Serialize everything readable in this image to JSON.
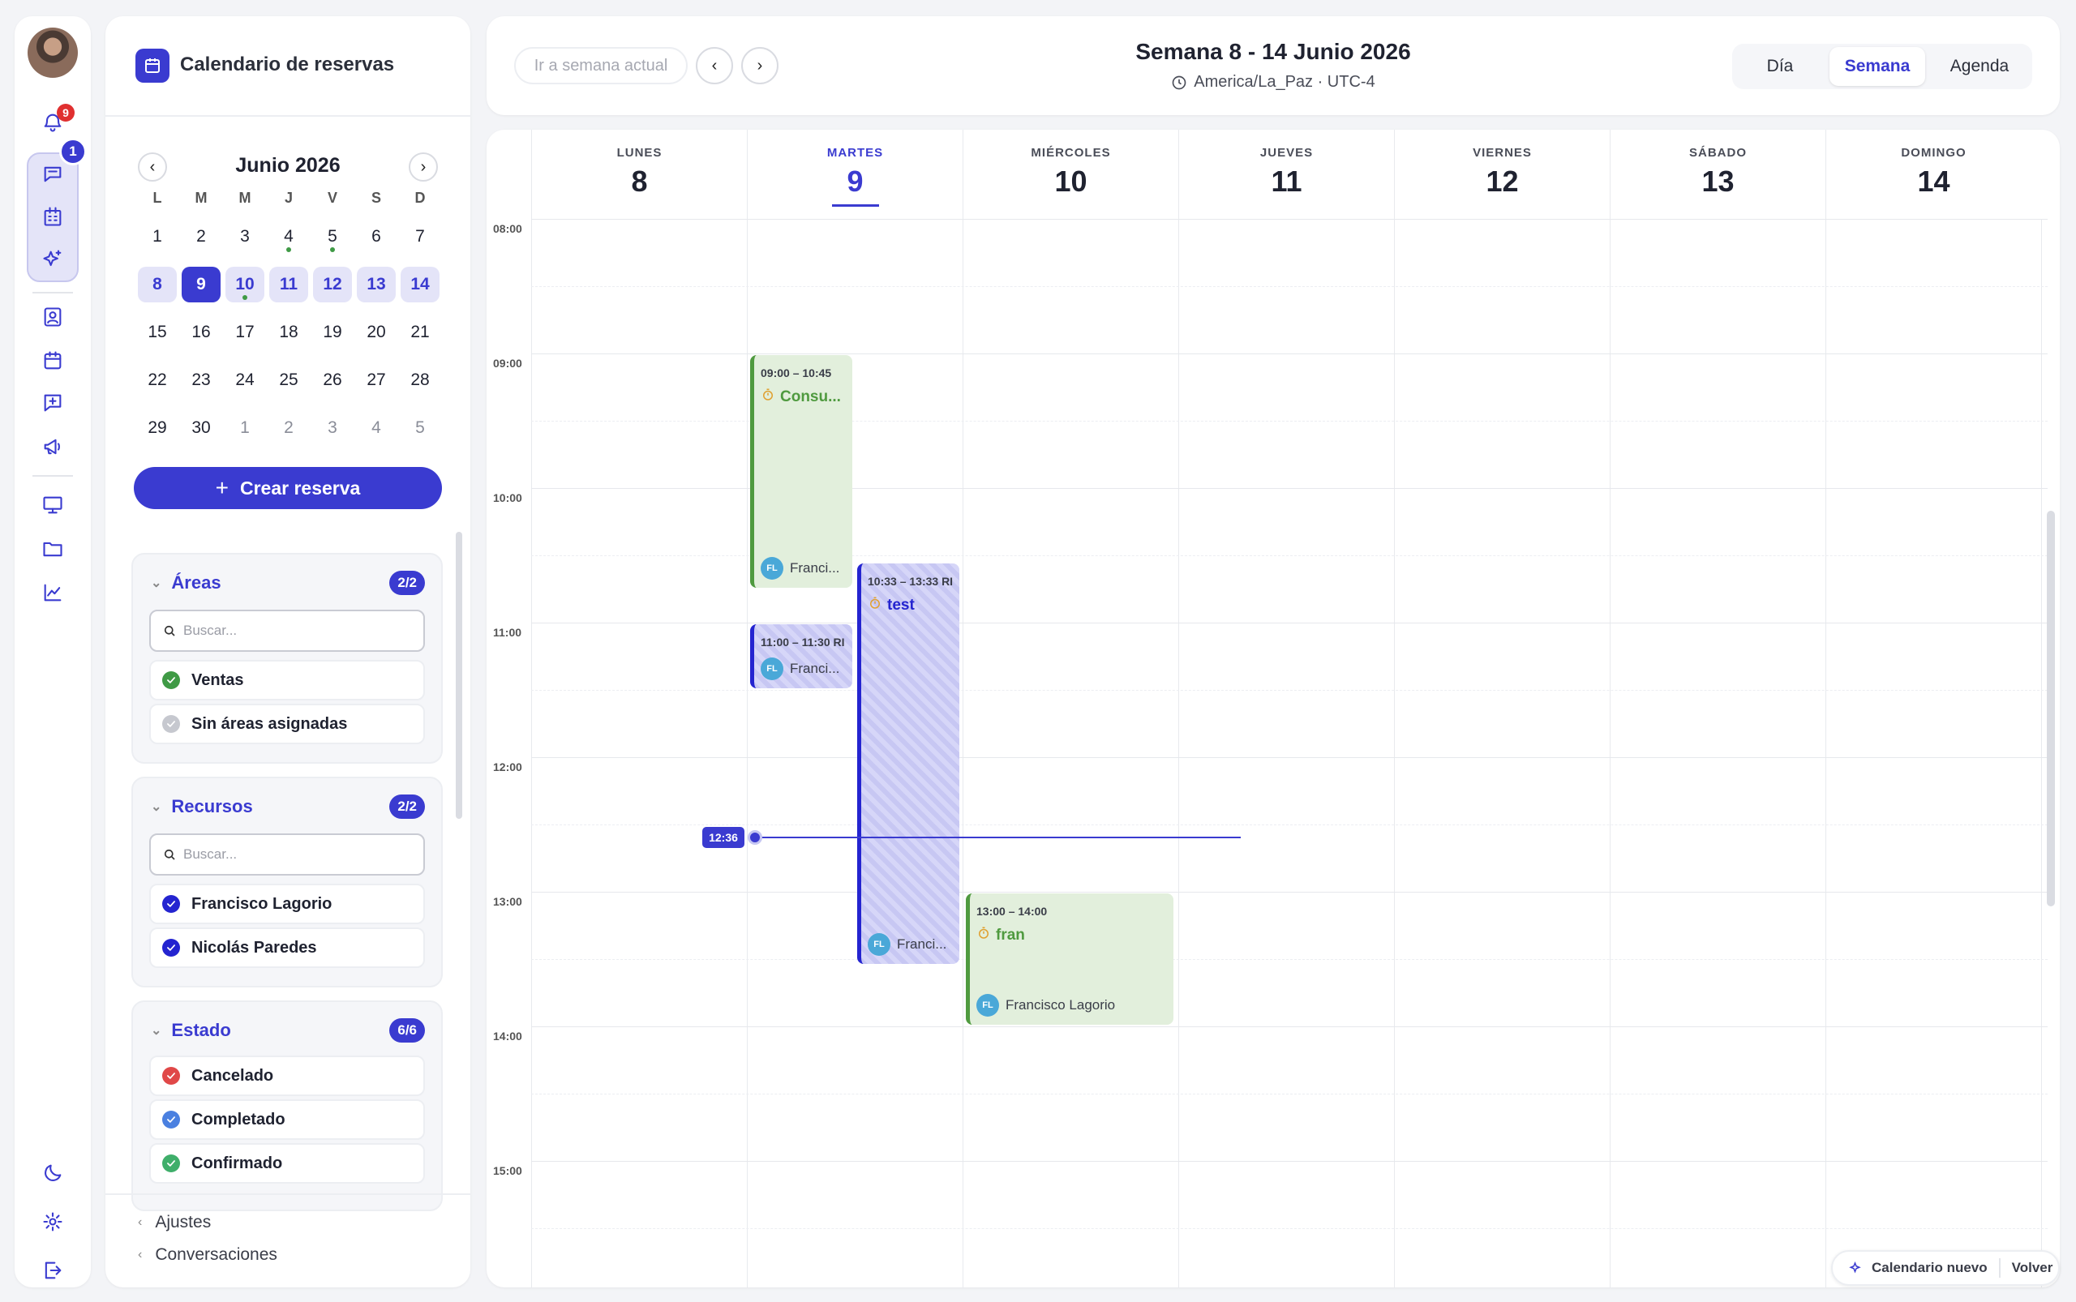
{
  "rail": {
    "notifications_badge": "9",
    "conversations_badge": "1",
    "icons": [
      "bell-icon",
      "chat-icon",
      "building-icon",
      "sparkles-icon",
      "contact-icon",
      "calendar-icon",
      "message-plus-icon",
      "megaphone-icon",
      "screen-chat-icon",
      "folder-icon",
      "chart-line-icon",
      "moon-icon",
      "gear-icon",
      "logout-icon"
    ]
  },
  "sidebar": {
    "title": "Calendario de reservas",
    "mini_calendar": {
      "month_label": "Junio 2026",
      "weekdays": [
        "L",
        "M",
        "M",
        "J",
        "V",
        "S",
        "D"
      ],
      "weeks": [
        [
          {
            "d": "1"
          },
          {
            "d": "2"
          },
          {
            "d": "3"
          },
          {
            "d": "4",
            "dot": true
          },
          {
            "d": "5",
            "dot": true
          },
          {
            "d": "6"
          },
          {
            "d": "7"
          }
        ],
        [
          {
            "d": "8",
            "wk": true
          },
          {
            "d": "9",
            "wk": true,
            "today": true
          },
          {
            "d": "10",
            "wk": true,
            "dot": true
          },
          {
            "d": "11",
            "wk": true
          },
          {
            "d": "12",
            "wk": true
          },
          {
            "d": "13",
            "wk": true
          },
          {
            "d": "14",
            "wk": true
          }
        ],
        [
          {
            "d": "15"
          },
          {
            "d": "16"
          },
          {
            "d": "17"
          },
          {
            "d": "18"
          },
          {
            "d": "19"
          },
          {
            "d": "20"
          },
          {
            "d": "21"
          }
        ],
        [
          {
            "d": "22"
          },
          {
            "d": "23"
          },
          {
            "d": "24"
          },
          {
            "d": "25"
          },
          {
            "d": "26"
          },
          {
            "d": "27"
          },
          {
            "d": "28"
          }
        ],
        [
          {
            "d": "29"
          },
          {
            "d": "30"
          },
          {
            "d": "1",
            "other": true
          },
          {
            "d": "2",
            "other": true
          },
          {
            "d": "3",
            "other": true
          },
          {
            "d": "4",
            "other": true
          },
          {
            "d": "5",
            "other": true
          }
        ]
      ]
    },
    "create_button": "Crear reserva",
    "areas": {
      "title": "Áreas",
      "count": "2/2",
      "search_placeholder": "Buscar...",
      "items": [
        {
          "label": "Ventas",
          "color": "#3f9a45"
        },
        {
          "label": "Sin áreas asignadas",
          "color": "#c6c8cf"
        }
      ]
    },
    "resources": {
      "title": "Recursos",
      "count": "2/2",
      "search_placeholder": "Buscar...",
      "items": [
        {
          "label": "Francisco Lagorio",
          "color": "#2424d0"
        },
        {
          "label": "Nicolás Paredes",
          "color": "#2424d0"
        }
      ]
    },
    "status": {
      "title": "Estado",
      "count": "6/6",
      "items": [
        {
          "label": "Cancelado",
          "color": "#e04848"
        },
        {
          "label": "Completado",
          "color": "#4a80e0"
        },
        {
          "label": "Confirmado",
          "color": "#3fae6a"
        }
      ]
    },
    "footer_links": [
      "Ajustes",
      "Conversaciones"
    ]
  },
  "topbar": {
    "goto_current": "Ir a semana actual",
    "week_title": "Semana 8 - 14 Junio 2026",
    "timezone": "America/La_Paz · UTC-4",
    "views": [
      {
        "label": "Día",
        "active": false
      },
      {
        "label": "Semana",
        "active": true
      },
      {
        "label": "Agenda",
        "active": false
      }
    ]
  },
  "grid": {
    "days": [
      {
        "name": "LUNES",
        "num": "8"
      },
      {
        "name": "MARTES",
        "num": "9",
        "today": true
      },
      {
        "name": "MIÉRCOLES",
        "num": "10"
      },
      {
        "name": "JUEVES",
        "num": "11"
      },
      {
        "name": "VIERNES",
        "num": "12"
      },
      {
        "name": "SÁBADO",
        "num": "13"
      },
      {
        "name": "DOMINGO",
        "num": "14"
      }
    ],
    "hours": [
      "08:00",
      "09:00",
      "10:00",
      "11:00",
      "12:00",
      "13:00",
      "14:00",
      "15:00"
    ],
    "now_label": "12:36",
    "events": [
      {
        "day": 1,
        "lane": "left",
        "time": "09:00 – 10:45",
        "title": "Consu...",
        "user": "Franci...",
        "initials": "FL",
        "style": "green",
        "start": 9.0,
        "end": 10.75
      },
      {
        "day": 1,
        "lane": "left",
        "time": "11:00 – 11:30 RI",
        "title": "",
        "user": "Franci...",
        "initials": "FL",
        "style": "blue",
        "start": 11.0,
        "end": 11.5
      },
      {
        "day": 1,
        "lane": "right",
        "time": "10:33 – 13:33 RI",
        "title": "test",
        "user": "Franci...",
        "initials": "FL",
        "style": "blue",
        "start": 10.55,
        "end": 13.55
      },
      {
        "day": 2,
        "lane": "full",
        "time": "13:00 – 14:00",
        "title": "fran",
        "user": "Francisco Lagorio",
        "initials": "FL",
        "style": "green",
        "start": 13.0,
        "end": 14.0
      }
    ]
  },
  "new_calendar": {
    "label": "Calendario nuevo",
    "back": "Volver"
  }
}
